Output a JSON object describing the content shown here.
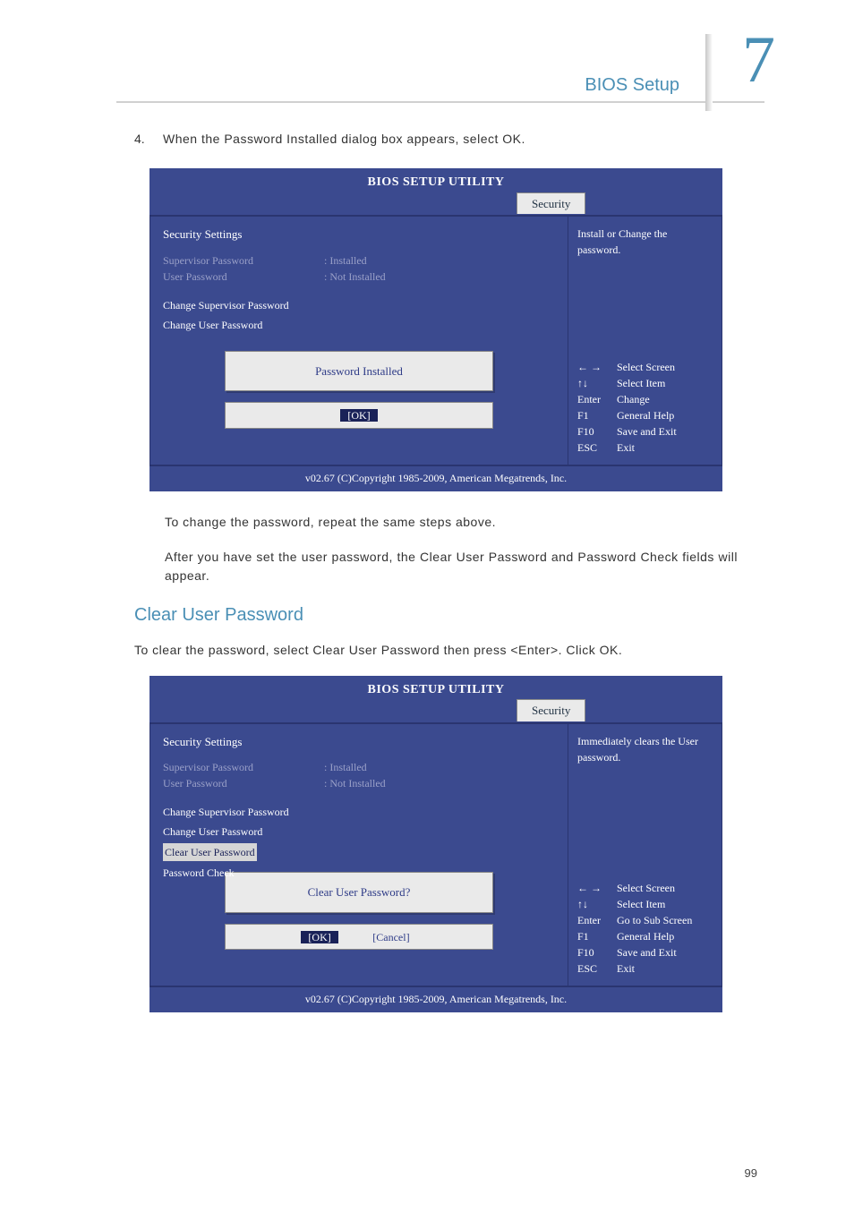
{
  "header": {
    "title": "BIOS Setup",
    "chapter_number": "7"
  },
  "step4": {
    "number": "4.",
    "text": "When the Password Installed dialog box appears, select OK."
  },
  "bios1": {
    "title": "BIOS SETUP UTILITY",
    "tab": "Security",
    "section_heading": "Security Settings",
    "rows": {
      "supervisor_label": "Supervisor Password",
      "supervisor_value": ":  Installed",
      "user_label": "User Password",
      "user_value": ":  Not Installed"
    },
    "menu": {
      "change_supervisor": "Change Supervisor Password",
      "change_user": "Change User Password"
    },
    "popup": {
      "message": "Password Installed",
      "ok": "[OK]"
    },
    "help_top": "Install or Change the password.",
    "keys": [
      {
        "k": "← →",
        "v": "Select Screen"
      },
      {
        "k": "↑↓",
        "v": "Select Item"
      },
      {
        "k": "Enter",
        "v": "Change"
      },
      {
        "k": "F1",
        "v": "General Help"
      },
      {
        "k": "F10",
        "v": "Save and Exit"
      },
      {
        "k": "ESC",
        "v": "Exit"
      }
    ],
    "footer": "v02.67 (C)Copyright 1985-2009, American Megatrends, Inc."
  },
  "para1": "To change the password, repeat the same steps above.",
  "para2": "After you have set the user password, the Clear User Password and Password Check fields will appear.",
  "section_title": "Clear User Password",
  "para3": "To clear the password, select Clear User Password then press <Enter>. Click OK.",
  "bios2": {
    "title": "BIOS SETUP UTILITY",
    "tab": "Security",
    "section_heading": "Security Settings",
    "rows": {
      "supervisor_label": "Supervisor Password",
      "supervisor_value": ":  Installed",
      "user_label": "User Password",
      "user_value": ":  Not Installed"
    },
    "menu": {
      "change_supervisor": "Change Supervisor Password",
      "change_user": "Change User Password",
      "clear_user": "Clear User Password",
      "password_check": "Password Check"
    },
    "popup": {
      "message": "Clear User Password?",
      "ok": "[OK]",
      "cancel": "[Cancel]"
    },
    "help_top": "Immediately clears the User password.",
    "keys": [
      {
        "k": "← →",
        "v": "Select Screen"
      },
      {
        "k": "↑↓",
        "v": "Select Item"
      },
      {
        "k": "Enter",
        "v": "Go to Sub Screen"
      },
      {
        "k": "F1",
        "v": "General Help"
      },
      {
        "k": "F10",
        "v": "Save and Exit"
      },
      {
        "k": "ESC",
        "v": "Exit"
      }
    ],
    "footer": "v02.67 (C)Copyright 1985-2009, American Megatrends, Inc."
  },
  "page_number": "99"
}
